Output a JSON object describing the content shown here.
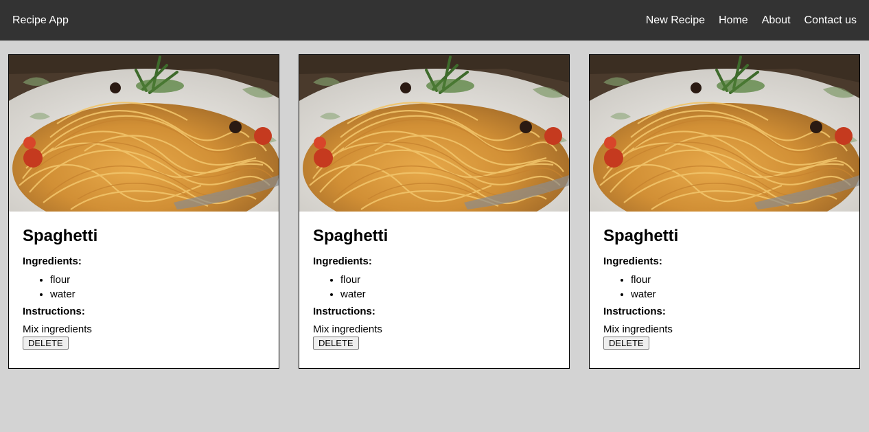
{
  "navbar": {
    "brand": "Recipe App",
    "links": [
      "New Recipe",
      "Home",
      "About",
      "Contact us"
    ]
  },
  "colors": {
    "navbar_bg": "#333333",
    "page_bg": "#d3d3d3",
    "card_bg": "#ffffff"
  },
  "recipes": [
    {
      "title": "Spaghetti",
      "ingredients_label": "Ingredients:",
      "ingredients": [
        "flour",
        "water"
      ],
      "instructions_label": "Instructions:",
      "instructions": "Mix ingredients",
      "delete_label": "DELETE",
      "photo": "spaghetti-photo"
    },
    {
      "title": "Spaghetti",
      "ingredients_label": "Ingredients:",
      "ingredients": [
        "flour",
        "water"
      ],
      "instructions_label": "Instructions:",
      "instructions": "Mix ingredients",
      "delete_label": "DELETE",
      "photo": "spaghetti-photo"
    },
    {
      "title": "Spaghetti",
      "ingredients_label": "Ingredients:",
      "ingredients": [
        "flour",
        "water"
      ],
      "instructions_label": "Instructions:",
      "instructions": "Mix ingredients",
      "delete_label": "DELETE",
      "photo": "spaghetti-photo"
    }
  ]
}
